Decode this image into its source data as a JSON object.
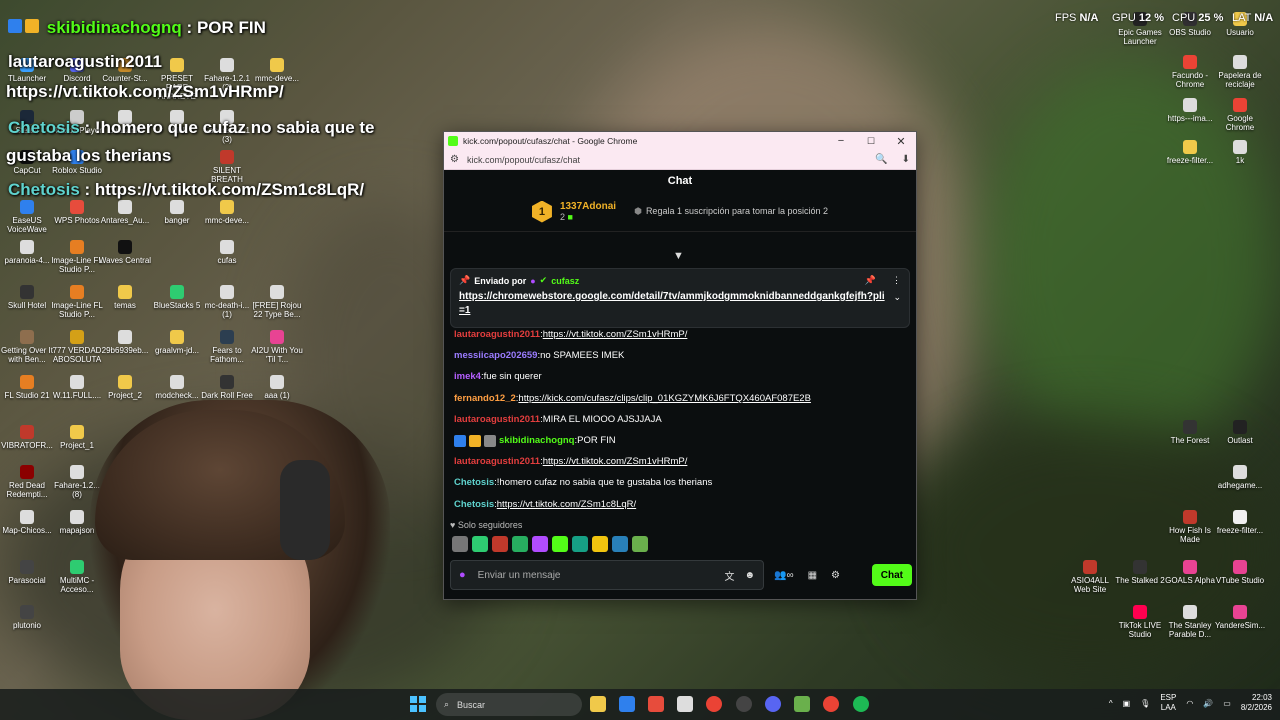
{
  "overlay": {
    "line1_user": "skibidinachognq",
    "line1_sep": ":",
    "line1_text": "POR FIN",
    "line2_user": "lautaroagustin2011",
    "line3_text": "https://vt.tiktok.com/ZSm1vHRmP/",
    "line4_user": "Chetosis",
    "line4_text": ": !homero que cufaz no sabia que te",
    "line5_text": "gustaba los therians",
    "line6_user": "Chetosis",
    "line6_text": ": https://vt.tiktok.com/ZSm1c8LqR/"
  },
  "hud": {
    "fps_label": "FPS",
    "fps_value": "N/A",
    "gpu_label": "GPU",
    "gpu_value": "12 %",
    "cpu_label": "CPU",
    "cpu_value": "25 %",
    "lat_label": "LAT",
    "lat_value": "N/A"
  },
  "desktop_icons": [
    {
      "label": "TLauncher",
      "color": "#3aa0ff"
    },
    {
      "label": "Discord",
      "color": "#5865f2"
    },
    {
      "label": "Counter-St...",
      "color": "#c48a2a"
    },
    {
      "label": "PRESET RARE ANAKEYE",
      "color": "#f0c94a"
    },
    {
      "label": "Fahare-1.2.1 (2)",
      "color": "#dddddd"
    },
    {
      "label": "mmc-deve...",
      "color": "#f0c94a"
    },
    {
      "label": "Steam",
      "color": "#1b2838"
    },
    {
      "label": "Roblox Player",
      "color": "#cccccc"
    },
    {
      "label": "luaaaanilli",
      "color": "#dddddd"
    },
    {
      "label": "WIN",
      "color": "#dddddd"
    },
    {
      "label": "Fahare-1.2.1 (3)",
      "color": "#dddddd"
    },
    {
      "label": "CapCut",
      "color": "#111111"
    },
    {
      "label": "Roblox Studio",
      "color": "#2f80ed"
    },
    {
      "label": "SILENT BREATH",
      "color": "#c0392b"
    },
    {
      "label": "EaseUS VoiceWave",
      "color": "#2f80ed"
    },
    {
      "label": "WPS Photos",
      "color": "#e74c3c"
    },
    {
      "label": "Antares_Au...",
      "color": "#dddddd"
    },
    {
      "label": "banger",
      "color": "#dddddd"
    },
    {
      "label": "mmc-deve...",
      "color": "#f0c94a"
    },
    {
      "label": "paranoia-4...",
      "color": "#dddddd"
    },
    {
      "label": "Image-Line FL Studio P...",
      "color": "#e67e22"
    },
    {
      "label": "Waves Central",
      "color": "#111111"
    },
    {
      "label": "cufas",
      "color": "#dddddd"
    },
    {
      "label": "Skull Hotel",
      "color": "#333333"
    },
    {
      "label": "Image-Line FL Studio P...",
      "color": "#e67e22"
    },
    {
      "label": "temas",
      "color": "#f0c94a"
    },
    {
      "label": "BlueStacks 5",
      "color": "#2ecc71"
    },
    {
      "label": "mc-death-i... (1)",
      "color": "#dddddd"
    },
    {
      "label": "[FREE] Rojou 22 Type Be...",
      "color": "#dddddd"
    },
    {
      "label": "Getting Over It with Ben...",
      "color": "#8e6e4e"
    },
    {
      "label": "777 VERDAD ABOSOLUTA",
      "color": "#d4a017"
    },
    {
      "label": "29b6939eb...",
      "color": "#dddddd"
    },
    {
      "label": "graalvm-jd...",
      "color": "#f0c94a"
    },
    {
      "label": "Fears to Fathom...",
      "color": "#2c3e50"
    },
    {
      "label": "AI2U With You 'Til T...",
      "color": "#e84393"
    },
    {
      "label": "FL Studio 21",
      "color": "#e67e22"
    },
    {
      "label": "W.11.FULL....",
      "color": "#dddddd"
    },
    {
      "label": "Project_2",
      "color": "#f0c94a"
    },
    {
      "label": "modcheck...",
      "color": "#dddddd"
    },
    {
      "label": "Dark Roll Free Kick...",
      "color": "#333333"
    },
    {
      "label": "aaa (1)",
      "color": "#dddddd"
    },
    {
      "label": "VIBRATOFR...",
      "color": "#c0392b"
    },
    {
      "label": "Project_1",
      "color": "#f0c94a"
    },
    {
      "label": "Red Dead Redempti...",
      "color": "#8b0000"
    },
    {
      "label": "Fahare-1.2... (8)",
      "color": "#dddddd"
    },
    {
      "label": "Map-Chicos...",
      "color": "#dddddd"
    },
    {
      "label": "mapajson",
      "color": "#dddddd"
    },
    {
      "label": "Parasocial",
      "color": "#444444"
    },
    {
      "label": "MultiMC - Acceso...",
      "color": "#2ecc71"
    },
    {
      "label": "plutonio",
      "color": "#444444"
    },
    {
      "label": "Epic Games Launcher",
      "color": "#222222"
    },
    {
      "label": "OBS Studio",
      "color": "#302e31"
    },
    {
      "label": "Usuario",
      "color": "#f0c94a"
    },
    {
      "label": "Facundo - Chrome",
      "color": "#ea4335"
    },
    {
      "label": "Papelera de reciclaje",
      "color": "#dddddd"
    },
    {
      "label": "https---ima...",
      "color": "#dddddd"
    },
    {
      "label": "Google Chrome",
      "color": "#ea4335"
    },
    {
      "label": "freeze-filter...",
      "color": "#f0c94a"
    },
    {
      "label": "1k",
      "color": "#dddddd"
    },
    {
      "label": "The Forest",
      "color": "#333333"
    },
    {
      "label": "Outlast",
      "color": "#222222"
    },
    {
      "label": "adhegame...",
      "color": "#dddddd"
    },
    {
      "label": "How Fish Is Made",
      "color": "#c0392b"
    },
    {
      "label": "freeze-filter...",
      "color": "#f0f0f0"
    },
    {
      "label": "ASIO4ALL Web Site",
      "color": "#c0392b"
    },
    {
      "label": "The Stalked 2",
      "color": "#333333"
    },
    {
      "label": "GOALS Alpha",
      "color": "#e84393"
    },
    {
      "label": "VTube Studio",
      "color": "#e84393"
    },
    {
      "label": "TikTok LIVE Studio",
      "color": "#ff0050"
    },
    {
      "label": "The Stanley Parable D...",
      "color": "#dddddd"
    },
    {
      "label": "YandereSim...",
      "color": "#e84393"
    }
  ],
  "window": {
    "title": "kick.com/popout/cufasz/chat - Google Chrome",
    "minimize": "−",
    "maximize": "☐",
    "close": "✕",
    "url": "kick.com/popout/cufasz/chat",
    "zoom_icon": "🔍",
    "download_icon": "⬇"
  },
  "chat": {
    "header": "Chat",
    "top_rank": "1",
    "top_user": "1337Adonai",
    "top_count": "2",
    "gift_text": "Regala 1 suscripción para tomar la posición 2",
    "pinned": {
      "sent_by": "Enviado por",
      "user": "cufasz",
      "link": "https://chromewebstore.google.com/detail/7tv/ammjkodgmmoknidbanneddgankgfejfh?pli=1"
    },
    "messages": [
      {
        "user": "lautaroagustin2011",
        "color": "#e33e3e",
        "text": "",
        "link": "https://vt.tiktok.com/ZSm1vHRmP/"
      },
      {
        "user": "messiicapo202659",
        "color": "#9b7cff",
        "text": "no SPAMEES IMEK",
        "link": ""
      },
      {
        "user": "imek4",
        "color": "#b55fff",
        "text": "fue sin querer",
        "link": ""
      },
      {
        "user": "fernando12_2",
        "color": "#ff9f43",
        "text": "",
        "link": "https://kick.com/cufasz/clips/clip_01KGZYMK6J6FTQX460AF087E2B"
      },
      {
        "user": "lautaroagustin2011",
        "color": "#e33e3e",
        "text": "MIRA EL MIOOO AJSJJAJA",
        "link": ""
      },
      {
        "user": "skibidinachognq",
        "color": "#53fc18",
        "text": "POR FIN",
        "link": ""
      },
      {
        "user": "lautaroagustin2011",
        "color": "#e33e3e",
        "text": "",
        "link": "https://vt.tiktok.com/ZSm1vHRmP/"
      },
      {
        "user": "Chetosis",
        "color": "#5fd3ce",
        "text": "!homero cufaz no sabia que te gustaba los therians",
        "link": ""
      },
      {
        "user": "Chetosis",
        "color": "#5fd3ce",
        "text": "",
        "link": "https://vt.tiktok.com/ZSm1c8LqR/"
      }
    ],
    "followers_only": "Solo seguidores",
    "input_placeholder": "Enviar un mensaje",
    "send_label": "Chat"
  },
  "taskbar": {
    "search_placeholder": "Buscar",
    "lang_top": "ESP",
    "lang_bottom": "LAA",
    "time": "22:03",
    "date": "8/2/2026"
  }
}
